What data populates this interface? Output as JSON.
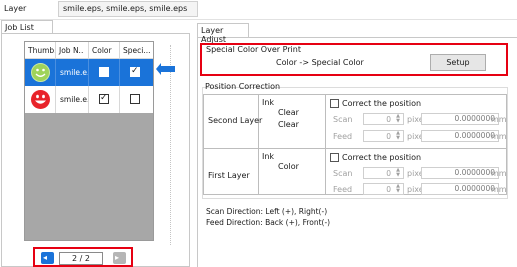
{
  "layer": {
    "label": "Layer",
    "name": "smile.eps, smile.eps, smile.eps"
  },
  "job_list": {
    "tab_label": "Job List",
    "columns": [
      "Thumb..",
      "Job N..",
      "Color",
      "Speci..."
    ],
    "rows": [
      {
        "job_name": "smile.e...",
        "color": false,
        "special": true,
        "selected": true
      },
      {
        "job_name": "smile.e...",
        "color": true,
        "special": false,
        "selected": false
      }
    ]
  },
  "pager": {
    "prev": "◂",
    "next": "▸",
    "page": "2 / 2"
  },
  "layer_adjust": {
    "tab_label": "Layer Adjust",
    "special_color": {
      "title": "Special Color Over Print",
      "text": "Color -> Special Color",
      "setup_label": "Setup"
    },
    "position_correction": {
      "title": "Position Correction",
      "rows": [
        {
          "layer": "Second Layer",
          "ink_label": "Ink",
          "ink_values": [
            "Clear",
            "Clear"
          ],
          "correct_label": "Correct the position",
          "scan_label": "Scan",
          "scan_value": "0",
          "scan_unit": "pixel",
          "scan_mm": "0.0000000",
          "mm": "mm",
          "feed_label": "Feed",
          "feed_value": "0",
          "feed_unit": "pixel",
          "feed_mm": "0.0000000"
        },
        {
          "layer": "First Layer",
          "ink_label": "Ink",
          "ink_values": [
            "Color"
          ],
          "correct_label": "Correct the position",
          "scan_label": "Scan",
          "scan_value": "0",
          "scan_unit": "pixel",
          "scan_mm": "0.0000000",
          "mm": "mm",
          "feed_label": "Feed",
          "feed_value": "0",
          "feed_unit": "pixel",
          "feed_mm": "0.0000000"
        }
      ],
      "scan_direction": "Scan Direction: Left (+),  Right(-)",
      "feed_direction": "Feed Direction: Back (+),  Front(-)"
    }
  },
  "colors": {
    "accent": "#1a73d9",
    "highlight": "#e60012",
    "selected_row": "#1a73d9"
  }
}
